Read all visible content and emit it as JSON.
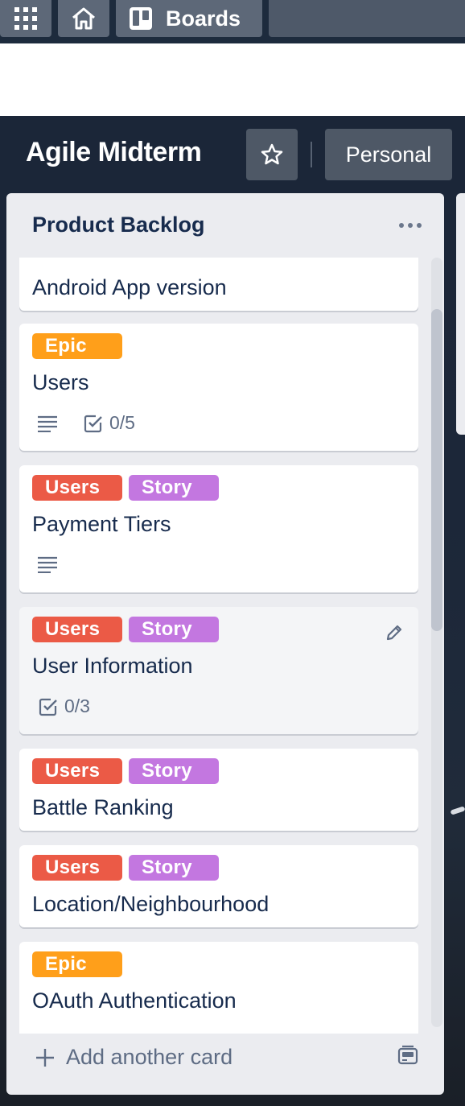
{
  "nav": {
    "apps_icon": "apps-grid-icon",
    "home_icon": "home-icon",
    "boards_icon": "boards-icon",
    "boards_label": "Boards"
  },
  "board": {
    "title": "Agile Midterm",
    "star_icon": "star-icon",
    "visibility_label": "Personal"
  },
  "list": {
    "title": "Product Backlog",
    "menu_icon": "more-horizontal-icon",
    "add_card_label": "Add another card",
    "template_icon": "card-template-icon"
  },
  "cards": [
    {
      "labels": [
        {
          "text": "",
          "color": "#ff9f1a"
        }
      ],
      "title": "Android App version"
    },
    {
      "labels": [
        {
          "text": "Epic",
          "color": "#ff9f1a"
        }
      ],
      "title": "Users",
      "has_description": true,
      "checklist": "0/5"
    },
    {
      "labels": [
        {
          "text": "Users",
          "color": "#eb5a46"
        },
        {
          "text": "Story",
          "color": "#c377e0"
        }
      ],
      "title": "Payment Tiers",
      "has_description": true
    },
    {
      "labels": [
        {
          "text": "Users",
          "color": "#eb5a46"
        },
        {
          "text": "Story",
          "color": "#c377e0"
        }
      ],
      "title": "User Information",
      "checklist": "0/3"
    },
    {
      "labels": [
        {
          "text": "Users",
          "color": "#eb5a46"
        },
        {
          "text": "Story",
          "color": "#c377e0"
        }
      ],
      "title": "Battle Ranking"
    },
    {
      "labels": [
        {
          "text": "Users",
          "color": "#eb5a46"
        },
        {
          "text": "Story",
          "color": "#c377e0"
        }
      ],
      "title": "Location/Neighbourhood"
    },
    {
      "labels": [
        {
          "text": "Epic",
          "color": "#ff9f1a"
        }
      ],
      "title": "OAuth Authentication"
    }
  ]
}
